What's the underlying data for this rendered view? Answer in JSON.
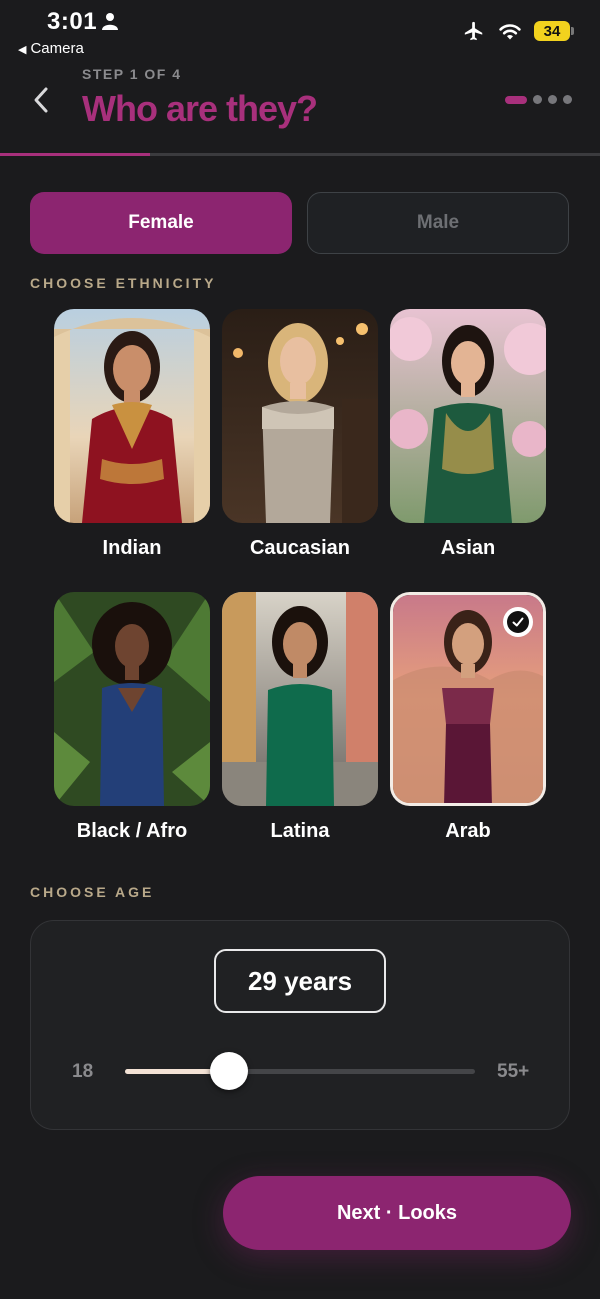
{
  "status_bar": {
    "time": "3:01",
    "back_app": "Camera",
    "battery": "34"
  },
  "header": {
    "step_label": "STEP 1 OF 4",
    "title": "Who are they?",
    "steps_total": 4,
    "current_step": 1
  },
  "gender": {
    "options": [
      "Female",
      "Male"
    ],
    "selected": "Female"
  },
  "ethnicity": {
    "label": "CHOOSE ETHNICITY",
    "options": [
      {
        "name": "Indian"
      },
      {
        "name": "Caucasian"
      },
      {
        "name": "Asian"
      },
      {
        "name": "Black / Afro"
      },
      {
        "name": "Latina"
      },
      {
        "name": "Arab"
      }
    ],
    "selected": "Arab"
  },
  "age": {
    "label": "CHOOSE AGE",
    "value_text": "29 years",
    "value": 29,
    "min_label": "18",
    "max_label": "55+",
    "min": 18,
    "max": 55
  },
  "next_button": {
    "label": "Next · Looks"
  },
  "colors": {
    "accent": "#a8307c",
    "button": "#8c2570",
    "section_label": "#b9a98a",
    "background": "#1b1b1d"
  }
}
